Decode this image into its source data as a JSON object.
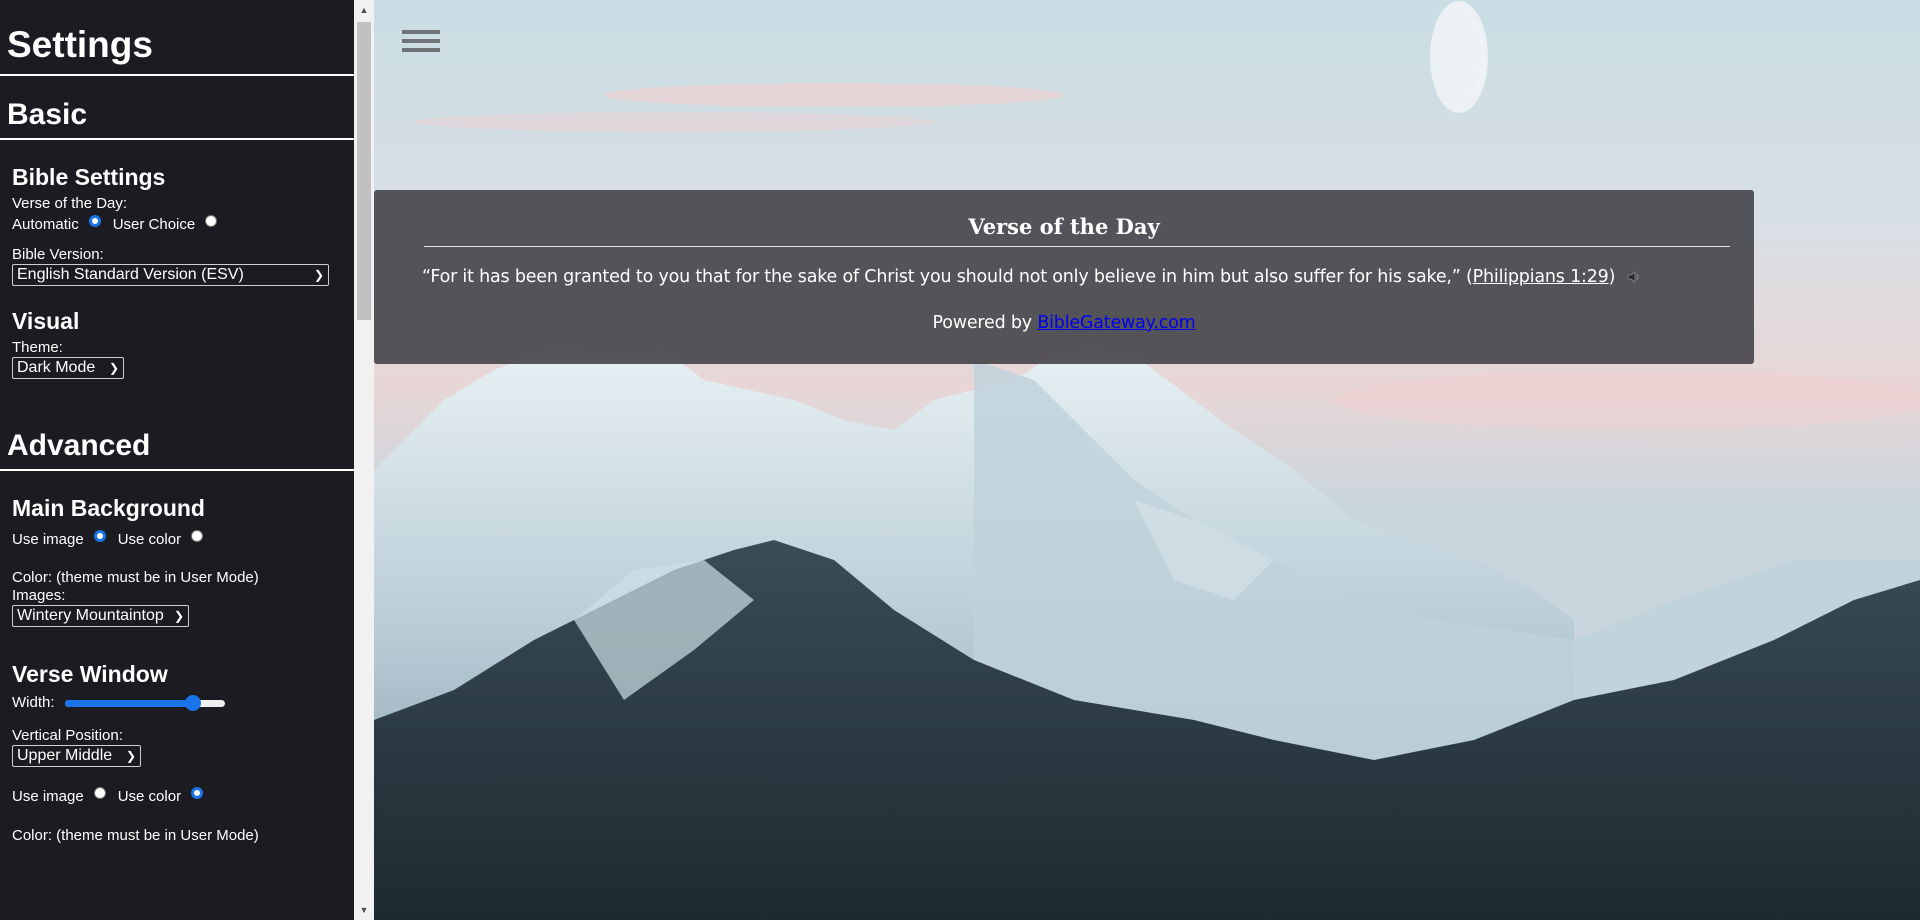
{
  "sidebar": {
    "title": "Settings",
    "basic": {
      "heading": "Basic",
      "bible_settings": {
        "heading": "Bible Settings",
        "votd_label": "Verse of the Day:",
        "option_automatic": "Automatic",
        "option_user_choice": "User Choice",
        "selected": "Automatic",
        "version_label": "Bible Version:",
        "version_value": "English Standard Version (ESV)"
      },
      "visual": {
        "heading": "Visual",
        "theme_label": "Theme:",
        "theme_value": "Dark Mode"
      }
    },
    "advanced": {
      "heading": "Advanced",
      "main_background": {
        "heading": "Main Background",
        "option_image": "Use image",
        "option_color": "Use color",
        "selected": "Use image",
        "color_label": "Color: (theme must be in User Mode)",
        "images_label": "Images:",
        "images_value": "Wintery Mountaintop"
      },
      "verse_window": {
        "heading": "Verse Window",
        "width_label": "Width:",
        "width_value": 0.8,
        "vpos_label": "Vertical Position:",
        "vpos_value": "Upper Middle",
        "option_image": "Use image",
        "option_color": "Use color",
        "selected": "Use color",
        "color_label": "Color: (theme must be in User Mode)"
      }
    }
  },
  "verse": {
    "title": "Verse of the Day",
    "text": "“For it has been granted to you that for the sake of Christ you should not only believe in him but also suffer for his sake,”",
    "open_paren": "(",
    "reference": "Philippians 1:29",
    "close_paren": ")",
    "powered_prefix": "Powered by ",
    "powered_link": "BibleGateway.com"
  },
  "colors": {
    "sidebar_bg": "#1c1b21",
    "accent": "#1a73e8",
    "card_bg": "rgba(60,60,66,0.86)"
  },
  "icons": {
    "menu": "hamburger-menu-icon",
    "audio": "speaker-icon"
  }
}
